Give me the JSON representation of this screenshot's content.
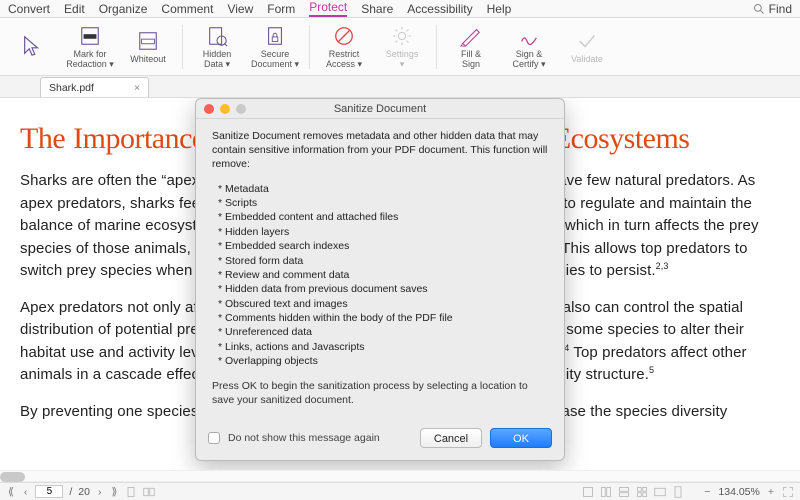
{
  "menubar": {
    "items": [
      "Convert",
      "Edit",
      "Organize",
      "Comment",
      "View",
      "Form",
      "Protect",
      "Share",
      "Accessibility",
      "Help"
    ],
    "selected_index": 6,
    "search_placeholder": "Find"
  },
  "toolbar": {
    "items": [
      {
        "label": "",
        "sub": "",
        "icon": "cursor"
      },
      {
        "label": "Mark for",
        "sub": "Redaction ▾",
        "icon": "redact"
      },
      {
        "label": "Whiteout",
        "sub": "",
        "icon": "whiteout"
      },
      {
        "sep": true
      },
      {
        "label": "Hidden",
        "sub": "Data ▾",
        "icon": "hidden"
      },
      {
        "label": "Secure",
        "sub": "Document ▾",
        "icon": "secure"
      },
      {
        "sep": true
      },
      {
        "label": "Restrict",
        "sub": "Access ▾",
        "icon": "restrict"
      },
      {
        "label": "Settings",
        "sub": "▾",
        "icon": "settings",
        "disabled": true
      },
      {
        "sep": true
      },
      {
        "label": "Fill &",
        "sub": "Sign",
        "icon": "fillsign"
      },
      {
        "label": "Sign &",
        "sub": "Certify ▾",
        "icon": "signcert"
      },
      {
        "label": "Validate",
        "sub": "",
        "icon": "validate",
        "disabled": true
      }
    ]
  },
  "tab": {
    "filename": "Shark.pdf",
    "close": "×"
  },
  "document": {
    "title": "The Importance of Sharks to Healthy Marine Ecosystems",
    "p1": "Sharks are often the “apex” or top predators in their ecosystems because they have few natural predators. As apex predators, sharks feed on the animals below them in the food web, helping to regulate and maintain the balance of marine ecosystems. Sharks directly limit the populations of their prey, which in turn affects the prey species of those animals, and so on. The diets of top predators are quite varied. This allows top predators to switch prey species when certain populations are low, thereby allowing prey species to persist.",
    "p1_sup": "2,3",
    "p2": "Apex predators not only affect population dynamics by consuming prey, but they also can control the spatial distribution of potential prey through intimidation. Fear of shark predation causes some species to alter their habitat use and activity level, causing effects that cascade through trophic levels.",
    "p2_sup1": "4",
    "p2_after": " Top predators affect other animals in a cascade effect throughout the ecosystem, thereby affecting community structure.",
    "p2_sup2": "5",
    "p3": "By preventing one species from monopolizing a limited resource, predators increase the species diversity"
  },
  "dialog": {
    "title": "Sanitize Document",
    "intro": "Sanitize Document removes metadata and other hidden data that may contain sensitive information from your PDF document. This function will remove:",
    "items": [
      "Metadata",
      "Scripts",
      "Embedded content and attached files",
      "Hidden layers",
      "Embedded search indexes",
      "Stored form data",
      "Review and comment data",
      "Hidden data from previous document saves",
      "Obscured text and images",
      "Comments hidden within the body of the PDF file",
      "Unreferenced data",
      "Links, actions and Javascripts",
      "Overlapping objects"
    ],
    "outro": "Press OK to begin the sanitization process by selecting a location to save your sanitized document.",
    "checkbox_label": "Do not show this message again",
    "cancel": "Cancel",
    "ok": "OK"
  },
  "status": {
    "page_current": "5",
    "page_sep": "/",
    "page_total": "20",
    "zoom": "134.05%"
  },
  "colors": {
    "accent": "#b63ca3",
    "title": "#e04a12",
    "ok_btn": "#1f7dff"
  }
}
